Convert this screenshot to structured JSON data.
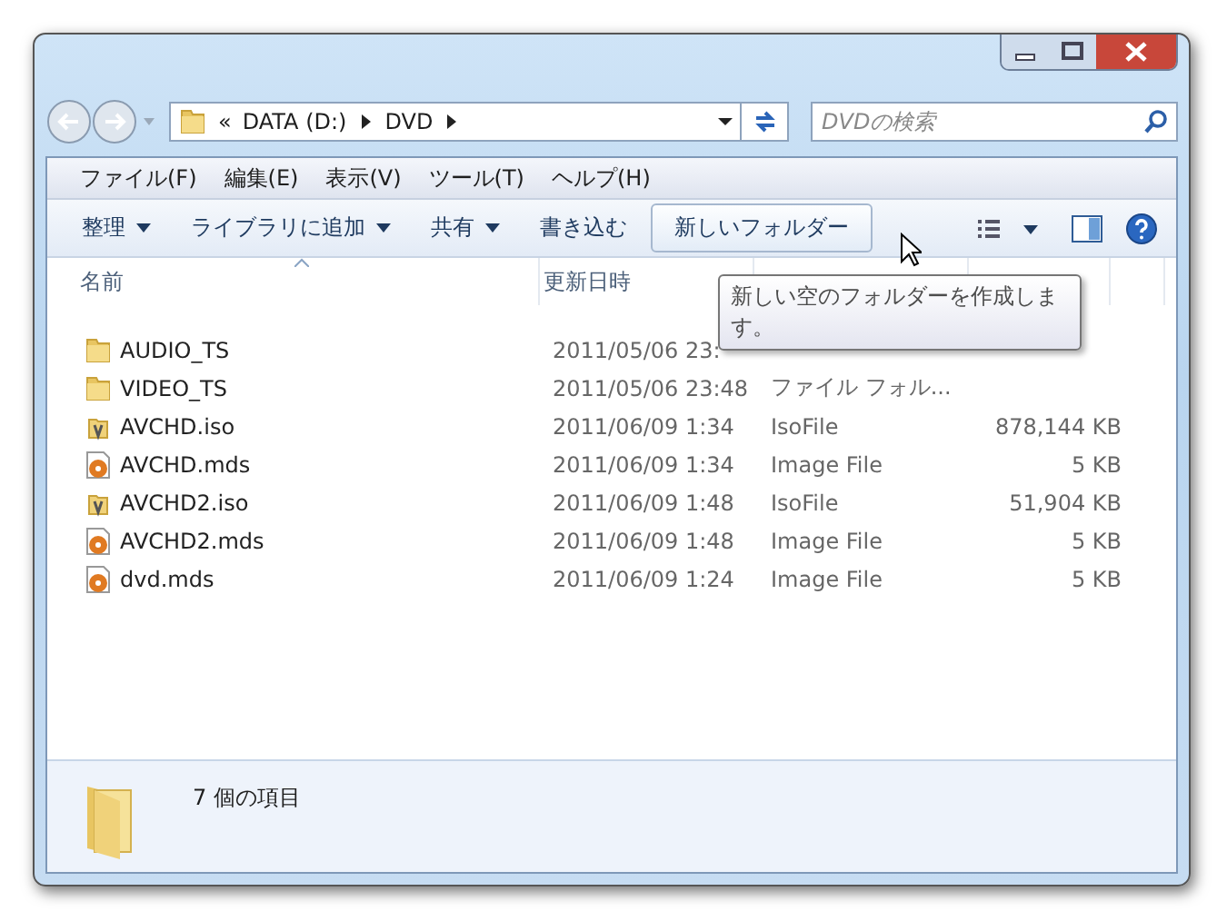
{
  "address": {
    "prefix": "«",
    "crumbs": [
      "DATA (D:)",
      "DVD"
    ]
  },
  "search": {
    "placeholder": "DVDの検索"
  },
  "menu": [
    "ファイル(F)",
    "編集(E)",
    "表示(V)",
    "ツール(T)",
    "ヘルプ(H)"
  ],
  "toolbar": [
    {
      "label": "整理",
      "kind": "dropdown",
      "hovered": false
    },
    {
      "label": "ライブラリに追加",
      "kind": "dropdown",
      "hovered": false
    },
    {
      "label": "共有",
      "kind": "dropdown",
      "hovered": false
    },
    {
      "label": "書き込む",
      "kind": "button",
      "hovered": false
    },
    {
      "label": "新しいフォルダー",
      "kind": "button",
      "hovered": true
    }
  ],
  "columns": [
    {
      "label": "名前",
      "sorted": true
    },
    {
      "label": "更新日時",
      "sorted": false
    }
  ],
  "rows": [
    {
      "kind": "folder",
      "name": "AUDIO_TS",
      "date": "2011/05/06 23:",
      "type": "",
      "size": ""
    },
    {
      "kind": "folder",
      "name": "VIDEO_TS",
      "date": "2011/05/06 23:48",
      "type": "ファイル フォル...",
      "size": ""
    },
    {
      "kind": "iso",
      "name": "AVCHD.iso",
      "date": "2011/06/09 1:34",
      "type": "IsoFile",
      "size": "878,144 KB"
    },
    {
      "kind": "mds",
      "name": "AVCHD.mds",
      "date": "2011/06/09 1:34",
      "type": "Image File",
      "size": "5 KB"
    },
    {
      "kind": "iso",
      "name": "AVCHD2.iso",
      "date": "2011/06/09 1:48",
      "type": "IsoFile",
      "size": "51,904 KB"
    },
    {
      "kind": "mds",
      "name": "AVCHD2.mds",
      "date": "2011/06/09 1:48",
      "type": "Image File",
      "size": "5 KB"
    },
    {
      "kind": "mds",
      "name": "dvd.mds",
      "date": "2011/06/09 1:24",
      "type": "Image File",
      "size": "5 KB"
    }
  ],
  "tooltip": "新しい空のフォルダーを作成します。",
  "status": "7 個の項目"
}
